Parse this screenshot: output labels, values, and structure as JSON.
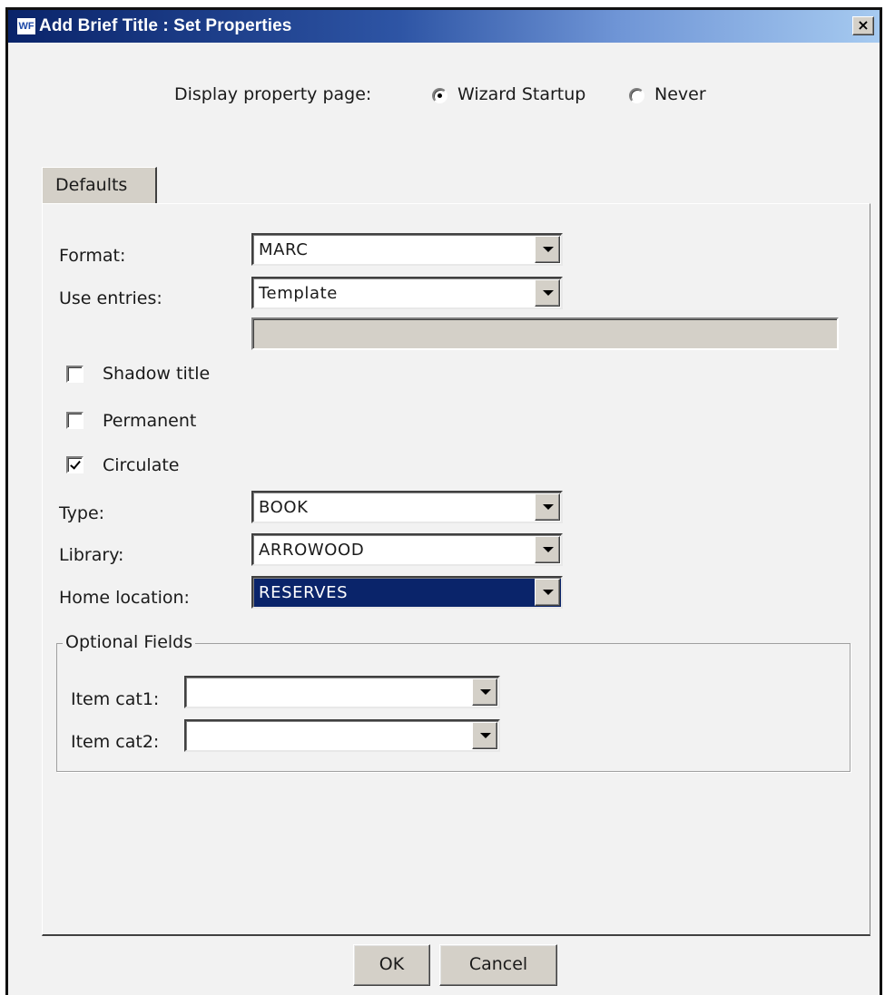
{
  "window": {
    "title": "Add Brief Title : Set Properties",
    "app_icon_label": "WF",
    "close_label": "×"
  },
  "display_property": {
    "label": "Display property page:",
    "options": [
      {
        "label": "Wizard Startup",
        "selected": true
      },
      {
        "label": "Never",
        "selected": false
      }
    ]
  },
  "tabs": [
    {
      "label": "Defaults",
      "active": true
    }
  ],
  "form": {
    "format": {
      "label": "Format:",
      "value": "MARC"
    },
    "use_entries": {
      "label": "Use entries:",
      "value": "Template",
      "extra_value": ""
    },
    "shadow_title": {
      "label": "Shadow title",
      "checked": false
    },
    "permanent": {
      "label": "Permanent",
      "checked": false
    },
    "circulate": {
      "label": "Circulate",
      "checked": true
    },
    "type": {
      "label": "Type:",
      "value": "BOOK"
    },
    "library": {
      "label": "Library:",
      "value": "ARROWOOD"
    },
    "home_location": {
      "label": "Home location:",
      "value": "RESERVES"
    }
  },
  "optional_fields": {
    "legend": "Optional Fields",
    "item_cat1": {
      "label": "Item cat1:",
      "value": ""
    },
    "item_cat2": {
      "label": "Item cat2:",
      "value": ""
    }
  },
  "buttons": {
    "ok": "OK",
    "cancel": "Cancel"
  },
  "colors": {
    "title_bar_start": "#0a246a",
    "title_bar_end": "#a6caf0",
    "selection": "#0a246a",
    "dialog_bg": "#f2f2f2",
    "control_face": "#d4d0c8"
  }
}
